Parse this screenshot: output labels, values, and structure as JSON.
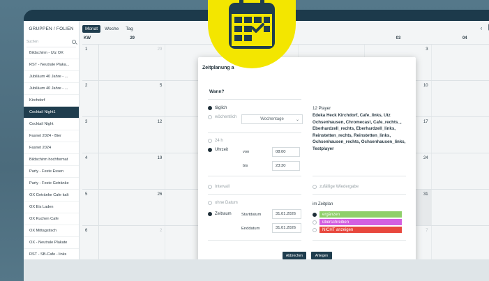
{
  "sidebar": {
    "header": "GRUPPEN / FOLIEN",
    "search_placeholder": "Suchen",
    "items": [
      "Bildschirm - Utz OX",
      "RST - Neutrale Plaka...",
      "Jubiläum 40 Jahre - ...",
      "Jubiläum 40 Jahre - ...",
      "Kirchdorf",
      "Cocktail Night1",
      "Cocktail Night",
      "Fasnet 2024 - Bier",
      "Fasnet 2024",
      "Bildschirm hochformat",
      "Party - Feste Essen",
      "Party - Feste Getränke",
      "OX Getränke Cafe kalt",
      "OX Eis Laden",
      "OX Kuchen Cafe",
      "OX Mittagstisch",
      "OX - Neutrale Plakate",
      "RST - SB-Cafe - links"
    ],
    "active_index": 5
  },
  "toolbar": {
    "views": [
      "Monat",
      "Woche",
      "Tag"
    ],
    "active_view": "Monat",
    "prev": "‹",
    "next": "›",
    "today": "He"
  },
  "calendar": {
    "kw_label": "KW",
    "header_days": [
      "29",
      "",
      "",
      "",
      "03",
      "04"
    ],
    "weeks": [
      {
        "kw": "1",
        "days": [
          "29",
          "",
          "",
          "",
          "3",
          ""
        ]
      },
      {
        "kw": "2",
        "days": [
          "5",
          "",
          "",
          "",
          "10",
          ""
        ]
      },
      {
        "kw": "3",
        "days": [
          "12",
          "",
          "",
          "",
          "17",
          ""
        ]
      },
      {
        "kw": "4",
        "days": [
          "19",
          "",
          "",
          "",
          "24",
          ""
        ]
      },
      {
        "kw": "5",
        "days": [
          "26",
          "",
          "",
          "",
          "31",
          ""
        ]
      },
      {
        "kw": "6",
        "days": [
          "2",
          "",
          "",
          "",
          "7",
          ""
        ]
      }
    ]
  },
  "modal": {
    "title": "Zeitplanung a",
    "wann": "Wann?",
    "taeglich": "täglich",
    "woechentlich": "wöchentlich",
    "wochentage": "Wochentage",
    "h24": "24 h",
    "uhrzeit": "Uhrzeit",
    "von_label": "von",
    "von_value": "08:00",
    "bis_label": "bis",
    "bis_value": "23:30",
    "intervall": "Intervall",
    "zufaellig": "zufällige Wiedergabe",
    "ohne_datum": "ohne Datum",
    "zeitraum": "Zeitraum",
    "startdatum_label": "Startdatum",
    "startdatum_value": "31.01.2026",
    "enddatum_label": "Enddatum",
    "enddatum_value": "31.01.2026",
    "players_title": "12 Player",
    "players_list": "Edeka Heck Kirchdorf, Cafe_links, Utz Ochsenhausen, Chromecast, Cafe_rechts_, Eberhardzell_rechts, Eberhardzell_links, Reinstetten_rechts, Reinstetten_links, Ochsenhausen_rechts, Ochsenhausen_links, Testplayer",
    "im_zeitplan": "im Zeitplan",
    "options": [
      {
        "label": "ergänzen",
        "color": "#8fcf6a"
      },
      {
        "label": "überschreiben",
        "color": "#d35fe0"
      },
      {
        "label": "NICHT anzeigen",
        "color": "#e8473d"
      }
    ],
    "abbrechen": "Abbrechen",
    "anlegen": "Anlegen"
  },
  "colors": {
    "frame": "#1f3d4e",
    "badge": "#f3e600",
    "badge_icon": "#1f3d4e"
  },
  "badge_icon": "calendar-check-icon"
}
